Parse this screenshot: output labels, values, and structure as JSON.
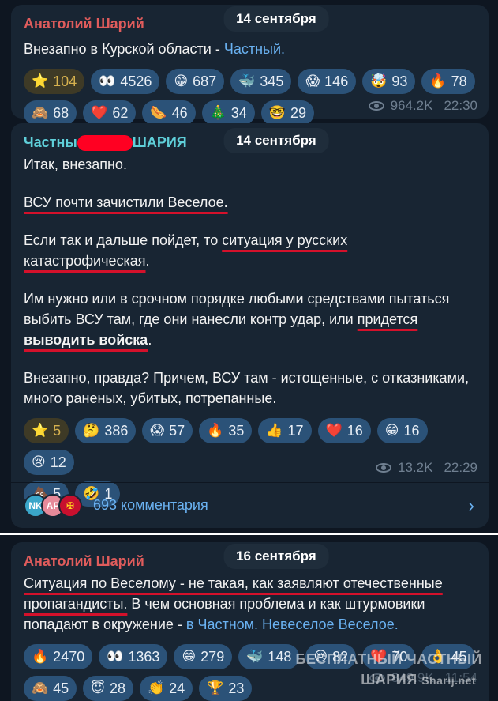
{
  "post1": {
    "author": "Анатолий Шарий",
    "date": "14 сентября",
    "text": "Внезапно в Курской области - ",
    "link": "Частный.",
    "reactions_row1": [
      {
        "emoji": "⭐",
        "count": "104",
        "gold": true
      },
      {
        "emoji": "👀",
        "count": "4526"
      },
      {
        "emoji": "😁",
        "count": "687"
      },
      {
        "emoji": "🐳",
        "count": "345"
      },
      {
        "emoji": "😱",
        "count": "146"
      },
      {
        "emoji": "🤯",
        "count": "93"
      },
      {
        "emoji": "🔥",
        "count": "78"
      }
    ],
    "reactions_row2": [
      {
        "emoji": "🙈",
        "count": "68"
      },
      {
        "emoji": "❤️",
        "count": "62"
      },
      {
        "emoji": "🌭",
        "count": "46"
      },
      {
        "emoji": "🎄",
        "count": "34"
      },
      {
        "emoji": "🤓",
        "count": "29"
      }
    ],
    "views": "964.2K",
    "time": "22:30"
  },
  "post2": {
    "author_start": "Частны",
    "author_end": "ШАРИЯ",
    "date": "14 сентября",
    "line1": "Итак, внезапно.",
    "line2": "ВСУ почти зачистили Веселое.",
    "line3a": "Если так и дальше пойдет, то ",
    "line3b": "ситуация у русских",
    "line3c": "катастрофическая",
    "line3d": ".",
    "line4a": "Им нужно или в срочном порядке любыми средствами пытаться выбить ВСУ там, где они нанесли контр удар, или ",
    "line4b": "придется ",
    "line4c": "выводить войска",
    "line4d": ".",
    "line5": "Внезапно, правда? Причем, ВСУ там - истощенные, с отказниками, много раненых, убитых, потрепанные.",
    "reactions_row1": [
      {
        "emoji": "⭐",
        "count": "5",
        "gold": true
      },
      {
        "emoji": "🤔",
        "count": "386"
      },
      {
        "emoji": "😱",
        "count": "57"
      },
      {
        "emoji": "🔥",
        "count": "35"
      },
      {
        "emoji": "👍",
        "count": "17"
      },
      {
        "emoji": "❤️",
        "count": "16"
      },
      {
        "emoji": "😁",
        "count": "16"
      },
      {
        "emoji": "😢",
        "count": "12"
      }
    ],
    "reactions_row2": [
      {
        "emoji": "💩",
        "count": "5"
      },
      {
        "emoji": "🤣",
        "count": "1"
      }
    ],
    "views": "13.2K",
    "time": "22:29",
    "avatars": [
      "NK",
      "AP",
      ""
    ],
    "comments": "693 комментария"
  },
  "post3": {
    "author": "Анатолий Шарий",
    "date": "16 сентября",
    "t1": "Ситуация по Веселому - не такая, как заявляют отечественные пропагандисты.",
    "t2": " В чем основная проблема и как штурмовики попадают в окружение - ",
    "link": "в Частном. Невеселое Веселое.",
    "reactions_row1": [
      {
        "emoji": "🔥",
        "count": "2470"
      },
      {
        "emoji": "👀",
        "count": "1363"
      },
      {
        "emoji": "😁",
        "count": "279"
      },
      {
        "emoji": "🐳",
        "count": "148"
      },
      {
        "emoji": "😢",
        "count": "82"
      },
      {
        "emoji": "❤️",
        "count": "70"
      },
      {
        "emoji": "👌",
        "count": "45"
      }
    ],
    "reactions_row2": [
      {
        "emoji": "🙈",
        "count": "45"
      },
      {
        "emoji": "😇",
        "count": "28"
      },
      {
        "emoji": "👏",
        "count": "24"
      },
      {
        "emoji": "🏆",
        "count": "23"
      }
    ],
    "views": "849.9K",
    "time": "11:54"
  },
  "watermark": {
    "line1": "БЕСПЛАТНЫЙ  ЧАСТНЫЙ",
    "line2": "ШАРИЯ",
    "line3": "Sharij.net"
  }
}
